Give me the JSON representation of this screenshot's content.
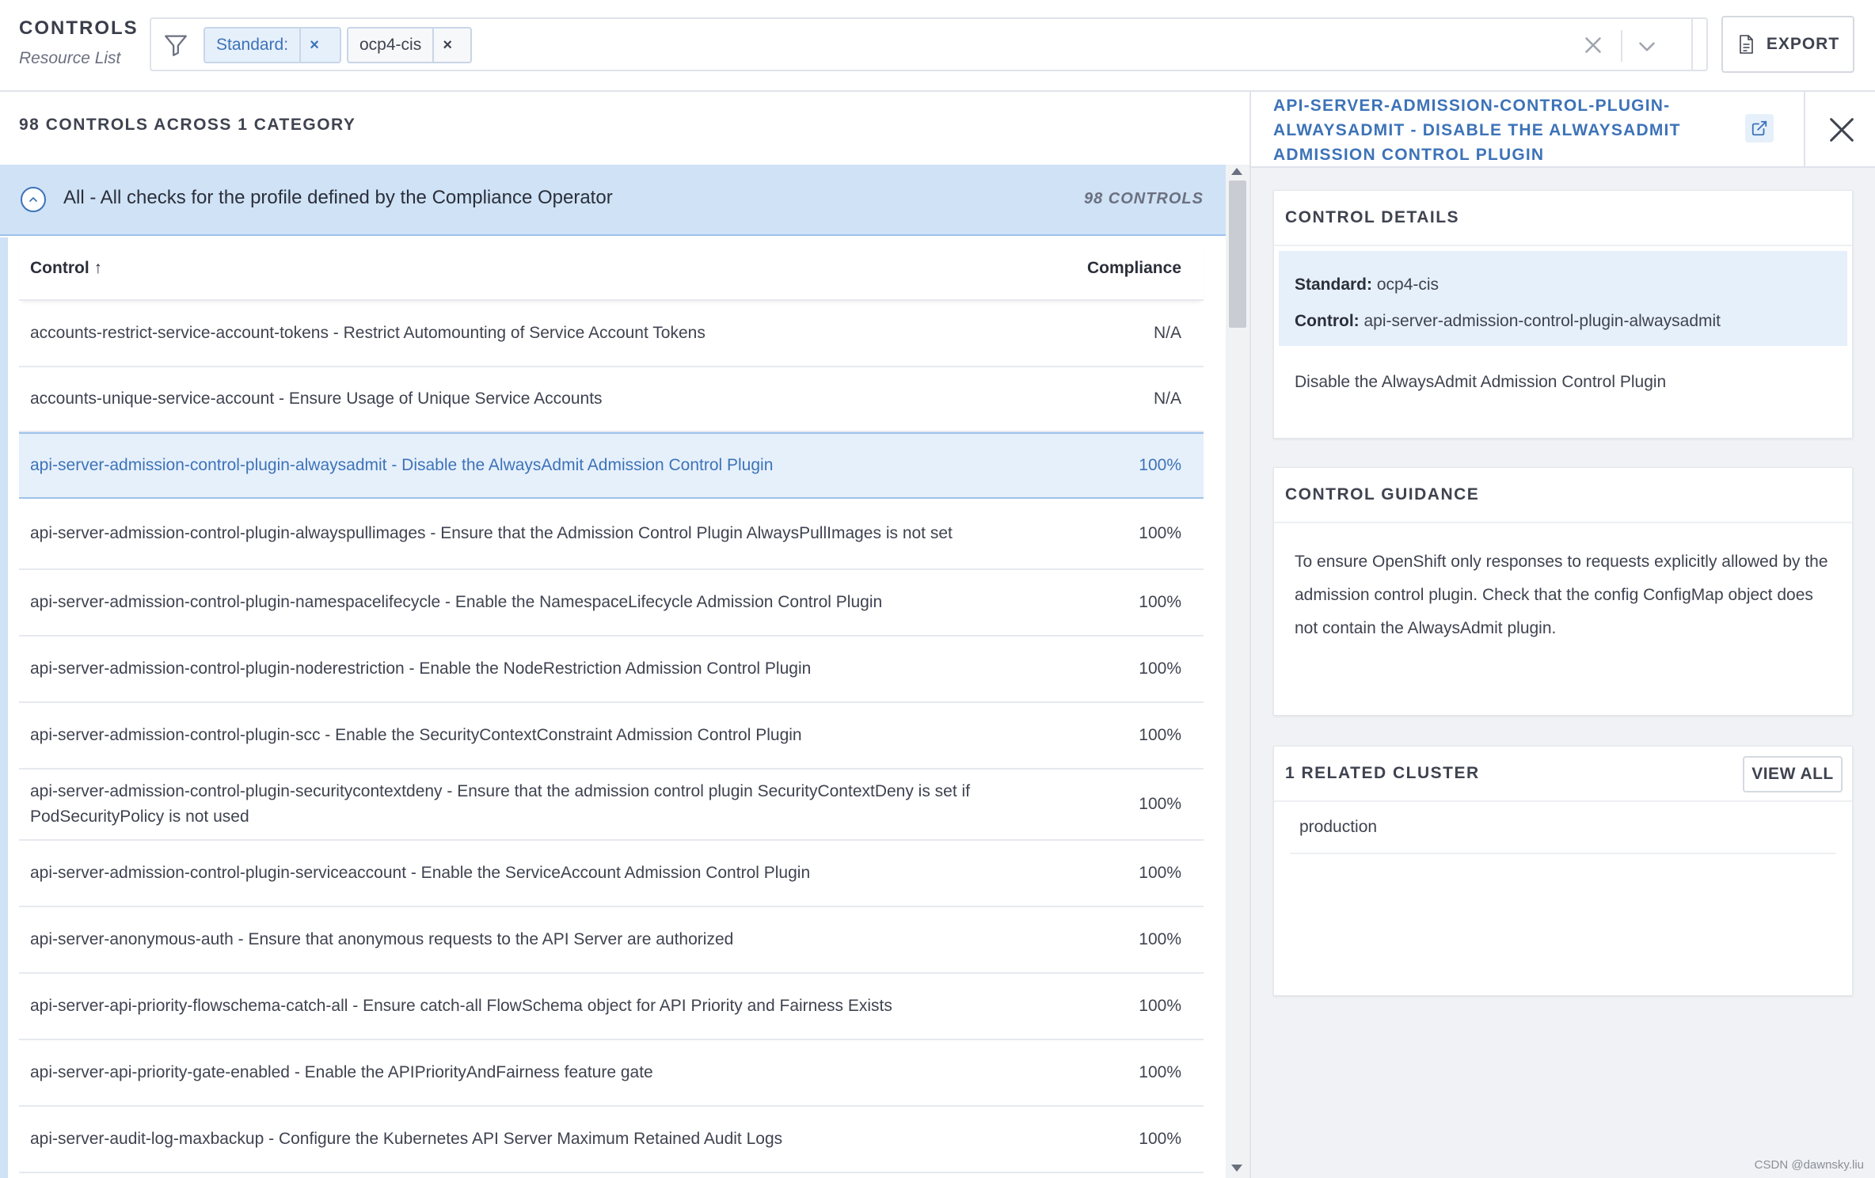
{
  "header": {
    "title": "CONTROLS",
    "subtitle": "Resource List",
    "filter_chips": [
      {
        "label": "Standard:",
        "remove": "×"
      },
      {
        "label": "ocp4-cis",
        "remove": "×"
      }
    ],
    "export_label": "EXPORT"
  },
  "summary": "98 CONTROLS ACROSS 1 CATEGORY",
  "group": {
    "title": "All - All checks for the profile defined by the Compliance Operator",
    "count": "98 CONTROLS"
  },
  "table": {
    "columns": [
      "Control ↑",
      "Compliance"
    ],
    "rows": [
      {
        "control": "accounts-restrict-service-account-tokens - Restrict Automounting of Service Account Tokens",
        "compliance": "N/A"
      },
      {
        "control": "accounts-unique-service-account - Ensure Usage of Unique Service Accounts",
        "compliance": "N/A"
      },
      {
        "control": "api-server-admission-control-plugin-alwaysadmit - Disable the AlwaysAdmit Admission Control Plugin",
        "compliance": "100%",
        "selected": true
      },
      {
        "control": "api-server-admission-control-plugin-alwayspullimages - Ensure that the Admission Control Plugin AlwaysPullImages is not set",
        "compliance": "100%"
      },
      {
        "control": "api-server-admission-control-plugin-namespacelifecycle - Enable the NamespaceLifecycle Admission Control Plugin",
        "compliance": "100%"
      },
      {
        "control": "api-server-admission-control-plugin-noderestriction - Enable the NodeRestriction Admission Control Plugin",
        "compliance": "100%"
      },
      {
        "control": "api-server-admission-control-plugin-scc - Enable the SecurityContextConstraint Admission Control Plugin",
        "compliance": "100%"
      },
      {
        "control": "api-server-admission-control-plugin-securitycontextdeny - Ensure that the admission control plugin SecurityContextDeny is set if PodSecurityPolicy is not used",
        "compliance": "100%"
      },
      {
        "control": "api-server-admission-control-plugin-serviceaccount - Enable the ServiceAccount Admission Control Plugin",
        "compliance": "100%"
      },
      {
        "control": "api-server-anonymous-auth - Ensure that anonymous requests to the API Server are authorized",
        "compliance": "100%"
      },
      {
        "control": "api-server-api-priority-flowschema-catch-all - Ensure catch-all FlowSchema object for API Priority and Fairness Exists",
        "compliance": "100%"
      },
      {
        "control": "api-server-api-priority-gate-enabled - Enable the APIPriorityAndFairness feature gate",
        "compliance": "100%"
      },
      {
        "control": "api-server-audit-log-maxbackup - Configure the Kubernetes API Server Maximum Retained Audit Logs",
        "compliance": "100%"
      }
    ]
  },
  "side_panel": {
    "title": "API-SERVER-ADMISSION-CONTROL-PLUGIN-ALWAYSADMIT - DISABLE THE ALWAYSADMIT ADMISSION CONTROL PLUGIN",
    "details": {
      "title": "CONTROL DETAILS",
      "standard_label": "Standard:",
      "standard_value": "ocp4-cis",
      "control_label": "Control:",
      "control_value": "api-server-admission-control-plugin-alwaysadmit",
      "description": "Disable the AlwaysAdmit Admission Control Plugin"
    },
    "guidance": {
      "title": "CONTROL GUIDANCE",
      "text": "To ensure OpenShift only responses to requests explicitly allowed by the admission control plugin. Check that the config ConfigMap object does not contain the AlwaysAdmit plugin."
    },
    "related": {
      "title": "1 RELATED CLUSTER",
      "view_all_label": "VIEW ALL",
      "clusters": [
        "production"
      ]
    }
  },
  "watermark": "CSDN @dawnsky.liu",
  "colors": {
    "accent": "#3d73b8",
    "selected_bg": "#e6f0fb",
    "group_bg": "#cfe2f6",
    "panel_bg": "#f1f2f5"
  }
}
